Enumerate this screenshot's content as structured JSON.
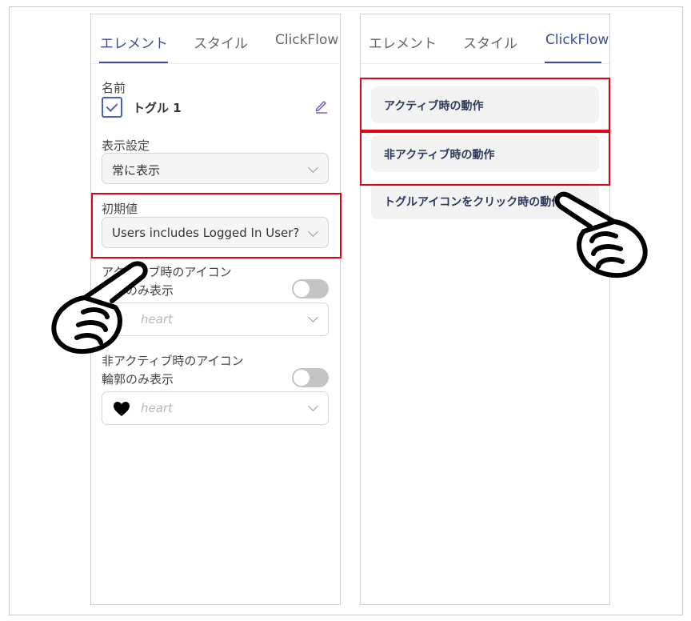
{
  "left_panel": {
    "tabs": [
      {
        "label": "エレメント",
        "active": true
      },
      {
        "label": "スタイル",
        "active": false
      },
      {
        "label": "ClickFlow",
        "active": false
      }
    ],
    "name_label": "名前",
    "name_value": "トグル 1",
    "visibility_label": "表示設定",
    "visibility_value": "常に表示",
    "initial_label": "初期値",
    "initial_value": "Users includes Logged In User?",
    "active_icon_label": "アクティブ時のアイコン",
    "outline_only_label": "輪郭のみ表示",
    "active_icon_value": "heart",
    "inactive_icon_label": "非アクティブ時のアイコン",
    "outline_only_label_2": "輪郭のみ表示",
    "inactive_icon_value": "heart"
  },
  "right_panel": {
    "tabs": [
      {
        "label": "エレメント",
        "active": false
      },
      {
        "label": "スタイル",
        "active": false
      },
      {
        "label": "ClickFlow",
        "active": true
      }
    ],
    "actions": [
      {
        "label": "アクティブ時の動作"
      },
      {
        "label": "非アクティブ時の動作"
      },
      {
        "label": "トグルアイコンをクリック時の動作"
      }
    ]
  },
  "colors": {
    "accent": "#3b4c9c",
    "highlight": "#e60012"
  },
  "icons": [
    "check-icon",
    "pencil-icon",
    "chevron-down-icon",
    "heart-icon",
    "pointing-hand-icon"
  ]
}
